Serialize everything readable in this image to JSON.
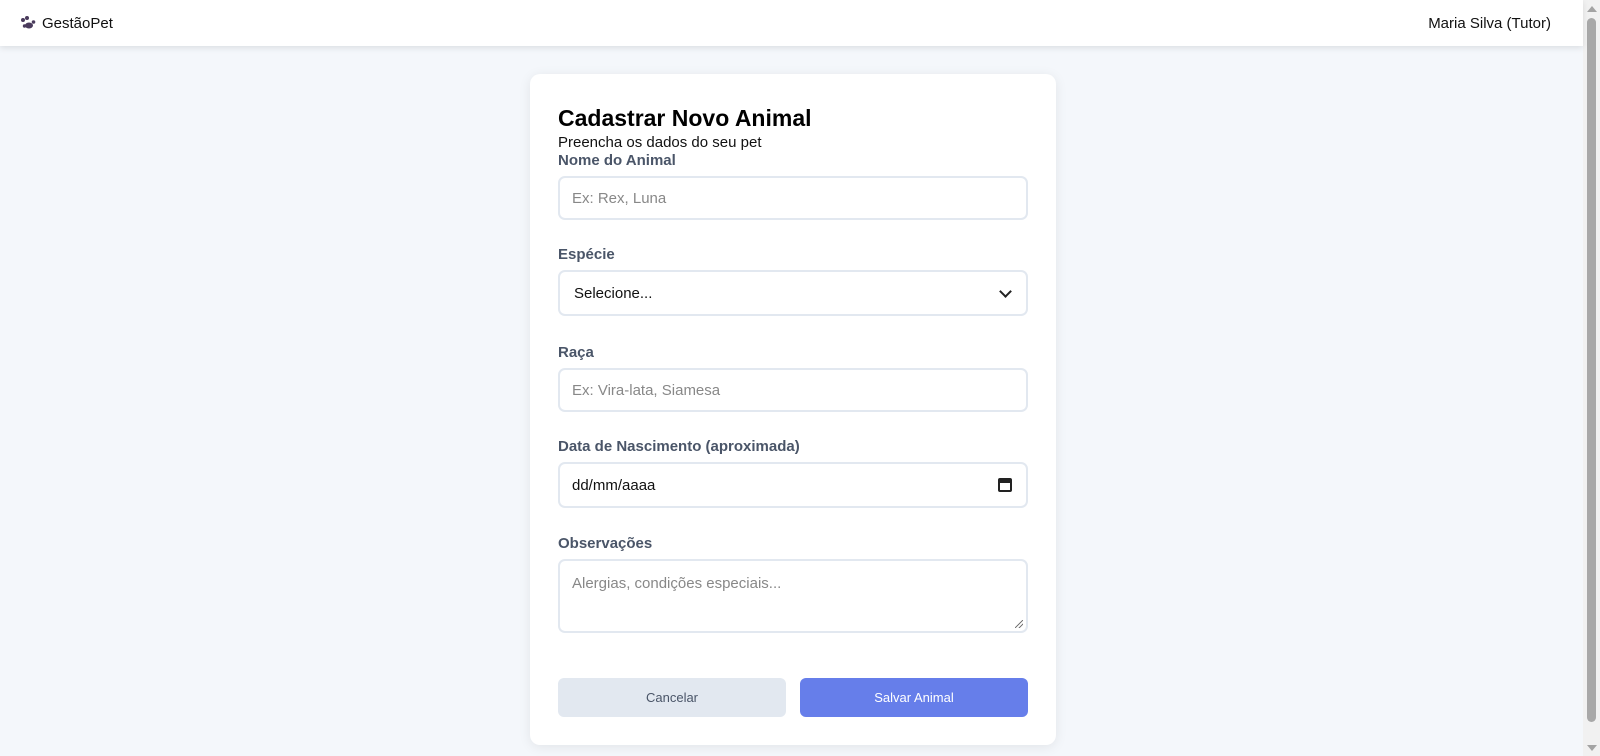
{
  "header": {
    "brand": "GestãoPet",
    "user": "Maria Silva (Tutor)"
  },
  "form": {
    "title": "Cadastrar Novo Animal",
    "subtitle": "Preencha os dados do seu pet",
    "name": {
      "label": "Nome do Animal",
      "placeholder": "Ex: Rex, Luna"
    },
    "species": {
      "label": "Espécie",
      "selected": "Selecione..."
    },
    "breed": {
      "label": "Raça",
      "placeholder": "Ex: Vira-lata, Siamesa"
    },
    "birthdate": {
      "label": "Data de Nascimento (aproximada)",
      "value": "dd/mm/aaaa"
    },
    "notes": {
      "label": "Observações",
      "placeholder": "Alergias, condições especiais..."
    },
    "cancel_label": "Cancelar",
    "save_label": "Salvar Animal"
  },
  "colors": {
    "primary": "#667eea",
    "secondary": "#e2e8f0",
    "label": "#4a5568",
    "background": "#f4f7fb"
  }
}
